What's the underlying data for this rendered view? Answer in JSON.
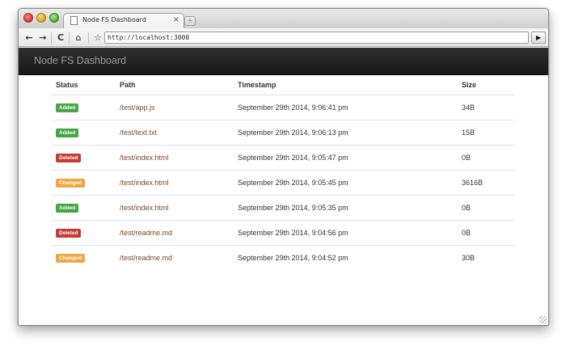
{
  "browser": {
    "tab_title": "Node FS Dashboard",
    "tab_close": "×",
    "new_tab": "+",
    "url": "http://localhost:3000",
    "nav": {
      "back": "←",
      "forward": "→",
      "reload": "C",
      "home": "⌂",
      "star": "☆",
      "go": "▶"
    }
  },
  "app": {
    "brand": "Node FS Dashboard"
  },
  "table": {
    "headers": {
      "status": "Status",
      "path": "Path",
      "timestamp": "Timestamp",
      "size": "Size"
    },
    "rows": [
      {
        "status": "Added",
        "path": "/test/app.js",
        "timestamp": "September 29th 2014, 9:06:41 pm",
        "size": "34B"
      },
      {
        "status": "Added",
        "path": "/test/text.txt",
        "timestamp": "September 29th 2014, 9:06:13 pm",
        "size": "15B"
      },
      {
        "status": "Deleted",
        "path": "/test/index.html",
        "timestamp": "September 29th 2014, 9:05:47 pm",
        "size": "0B"
      },
      {
        "status": "Changed",
        "path": "/test/index.html",
        "timestamp": "September 29th 2014, 9:05:45 pm",
        "size": "3616B"
      },
      {
        "status": "Added",
        "path": "/test/index.html",
        "timestamp": "September 29th 2014, 9:05:35 pm",
        "size": "0B"
      },
      {
        "status": "Deleted",
        "path": "/test/readme.md",
        "timestamp": "September 29th 2014, 9:04:56 pm",
        "size": "0B"
      },
      {
        "status": "Changed",
        "path": "/test/readme.md",
        "timestamp": "September 29th 2014, 9:04:52 pm",
        "size": "30B"
      }
    ]
  },
  "colors": {
    "added": "#46a546",
    "deleted": "#c43c35",
    "changed": "#f0a742",
    "navbar": "#222222",
    "link": "#7a4a2a"
  }
}
